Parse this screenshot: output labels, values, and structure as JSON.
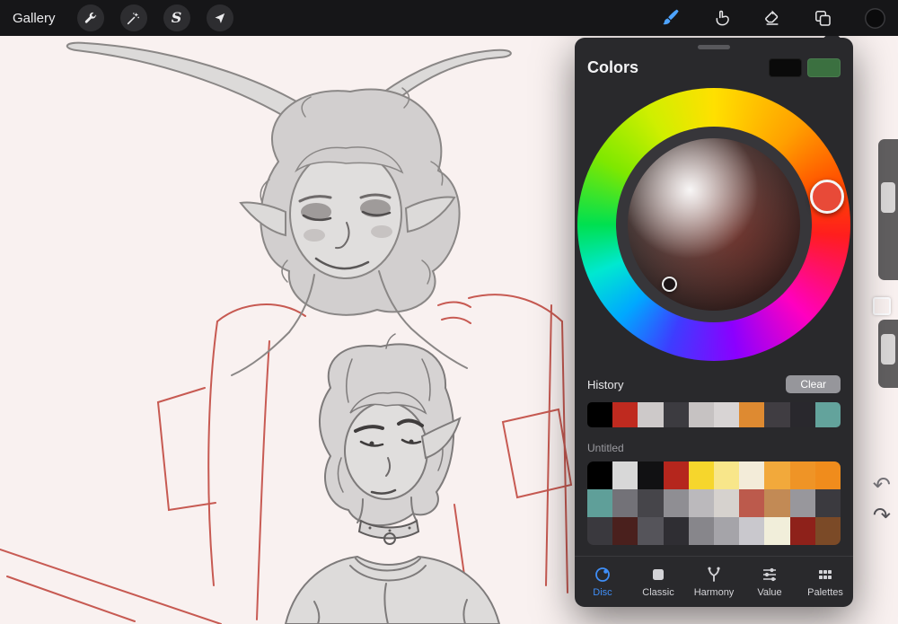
{
  "topbar": {
    "gallery": "Gallery",
    "selection_glyph": "S"
  },
  "colors_panel": {
    "title": "Colors",
    "accent": "#3f8ef7",
    "current_colors": {
      "primary": "#0a0a0a",
      "secondary": "#3b7040"
    },
    "wheel": {
      "hue_knob_color": "#e84a38"
    },
    "history": {
      "label": "History",
      "clear_label": "Clear",
      "swatches": [
        "#000000",
        "#bf2a1f",
        "#cdc9c9",
        "#3c3b40",
        "#c6c2c2",
        "#d8d4d4",
        "#de8a31",
        "#403d42",
        "#29282d",
        "#63a39c"
      ]
    },
    "palette": {
      "name": "Untitled",
      "rows": [
        [
          "#000000",
          "#d8d8d8",
          "#111113",
          "#b5261d",
          "#f6d62c",
          "#f8e68a",
          "#f3ecd9",
          "#f2a93b",
          "#ef9426",
          "#f08c1c"
        ],
        [
          "#5f9f99",
          "#737278",
          "#46454a",
          "#8f8e93",
          "#bbb9bc",
          "#d6d2ce",
          "#bc5a4c",
          "#c28a55",
          "#98979c",
          "#3b3a3f"
        ],
        [
          "#3a393e",
          "#4a201d",
          "#55545a",
          "#2f2e33",
          "#87868b",
          "#a5a4a9",
          "#c9c8cd",
          "#f1eeda",
          "#8e211a",
          "#7b4a27"
        ]
      ]
    },
    "tabs": [
      {
        "id": "disc",
        "label": "Disc",
        "active": true
      },
      {
        "id": "classic",
        "label": "Classic",
        "active": false
      },
      {
        "id": "harmony",
        "label": "Harmony",
        "active": false
      },
      {
        "id": "value",
        "label": "Value",
        "active": false
      },
      {
        "id": "palettes",
        "label": "Palettes",
        "active": false
      }
    ]
  }
}
